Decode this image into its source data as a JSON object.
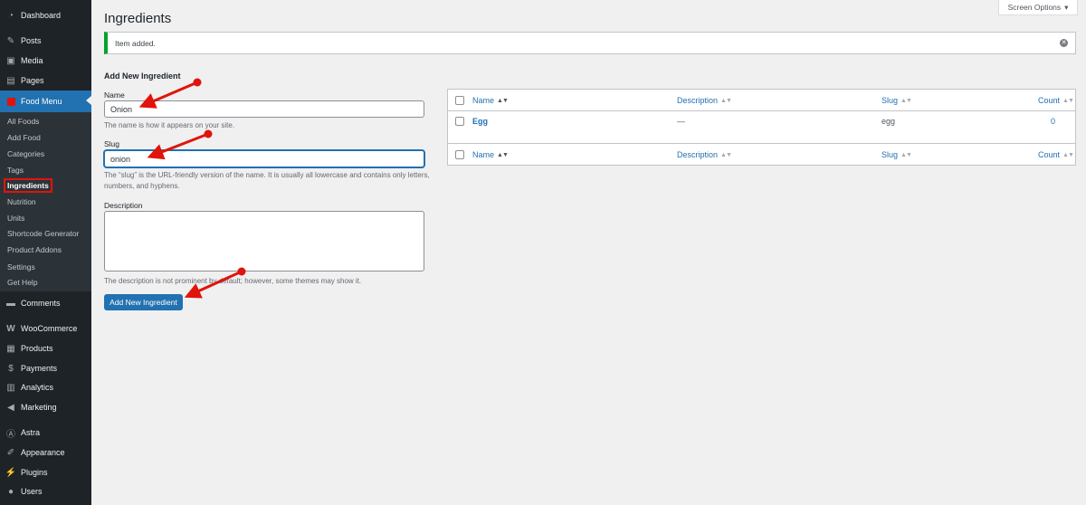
{
  "sidebar": {
    "top_items": [
      {
        "label": "Dashboard",
        "icon": "dashboard-icon"
      },
      {
        "label": "Posts",
        "icon": "pin-icon"
      },
      {
        "label": "Media",
        "icon": "media-icon"
      },
      {
        "label": "Pages",
        "icon": "pages-icon"
      },
      {
        "label": "Food Menu",
        "icon": "food-menu-icon"
      }
    ],
    "submenu": [
      "All Foods",
      "Add Food",
      "Categories",
      "Tags",
      "Ingredients",
      "Nutrition",
      "Units",
      "Shortcode Generator",
      "Product Addons",
      "Settings",
      "Get Help"
    ],
    "bottom_items": [
      {
        "label": "Comments",
        "icon": "comment-icon"
      },
      {
        "label": "WooCommerce",
        "icon": "woocommerce-icon"
      },
      {
        "label": "Products",
        "icon": "products-icon"
      },
      {
        "label": "Payments",
        "icon": "payments-icon"
      },
      {
        "label": "Analytics",
        "icon": "analytics-icon"
      },
      {
        "label": "Marketing",
        "icon": "marketing-icon"
      },
      {
        "label": "Astra",
        "icon": "astra-icon"
      },
      {
        "label": "Appearance",
        "icon": "appearance-icon"
      },
      {
        "label": "Plugins",
        "icon": "plugins-icon"
      },
      {
        "label": "Users",
        "icon": "users-icon"
      }
    ]
  },
  "header": {
    "title": "Ingredients",
    "screen_options": "Screen Options"
  },
  "notice": {
    "text": "Item added."
  },
  "form": {
    "title": "Add New Ingredient",
    "name_label": "Name",
    "name_value": "Onion",
    "name_help": "The name is how it appears on your site.",
    "slug_label": "Slug",
    "slug_value": "onion",
    "slug_help": "The “slug” is the URL-friendly version of the name. It is usually all lowercase and contains only letters, numbers, and hyphens.",
    "description_label": "Description",
    "description_help": "The description is not prominent by default; however, some themes may show it.",
    "submit_label": "Add New Ingredient"
  },
  "table": {
    "columns": [
      "Name",
      "Description",
      "Slug",
      "Count"
    ],
    "rows": [
      {
        "name": "Egg",
        "description": "—",
        "slug": "egg",
        "count": "0"
      }
    ]
  },
  "colors": {
    "sidebar_bg": "#1d2327",
    "accent": "#2271b1",
    "notice_success": "#00a32a",
    "annotation": "#e0140c"
  }
}
